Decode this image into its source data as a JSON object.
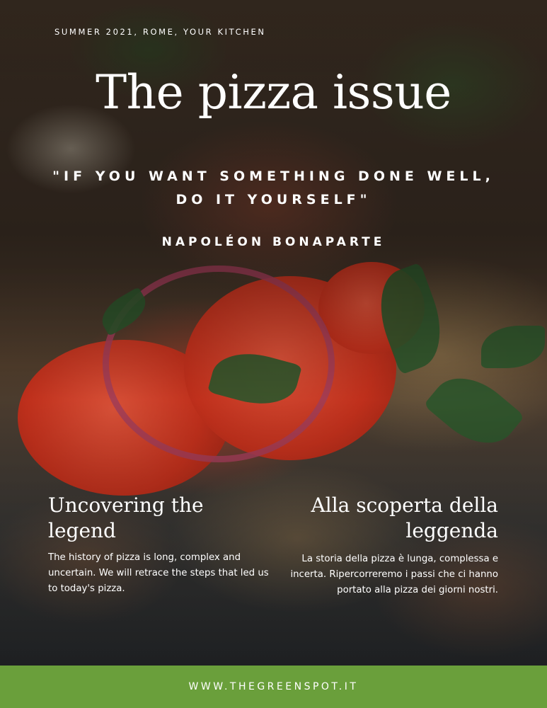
{
  "header": {
    "tagline": "SUMMER  2021, ROME, YOUR KITCHEN",
    "title": "The pizza issue",
    "quote": "\"IF YOU WANT SOMETHING DONE WELL, DO IT YOURSELF\"",
    "author": "NAPOLÉON BONAPARTE"
  },
  "english": {
    "heading": "Uncovering the legend",
    "body": "The history of pizza is long, complex and uncertain. We will retrace the steps that led us to today's pizza."
  },
  "italian": {
    "heading": "Alla scoperta della leggenda",
    "body": "La storia della pizza è lunga, complessa e incerta. Ripercorreremo i passi che ci hanno portato alla pizza dei giorni nostri."
  },
  "footer": {
    "url": "WWW.THEGREENSPOT.IT"
  },
  "colors": {
    "footer_green": "#6a9f3b",
    "text": "#ffffff"
  }
}
